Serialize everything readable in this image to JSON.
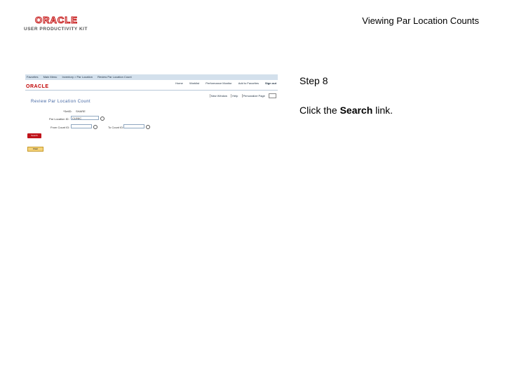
{
  "logo": {
    "wordmark": "ORACLE",
    "tagline": "USER PRODUCTIVITY KIT"
  },
  "document_title": "Viewing Par Location Counts",
  "step": {
    "label": "Step 8",
    "instruction_prefix": "Click the ",
    "instruction_bold": "Search",
    "instruction_suffix": " link."
  },
  "screenshot": {
    "nav_path": [
      "Favorites",
      "Main Menu",
      "Inventory > Par Location",
      "Review Par Location Count"
    ],
    "brand": "ORACLE",
    "top_links": [
      "Home",
      "Worklist",
      "Performance Monitor",
      "Add to Favorites",
      "Sign out"
    ],
    "util_links": [
      "New Window",
      "Help",
      "Personalize Page"
    ],
    "page_heading": "Review Par Location Count",
    "fields": {
      "setid_label": "*SetID:",
      "setid_value": "SHARE",
      "par_location_label": "Par Location ID:",
      "par_location_value": "CLINIC",
      "from_count_label": "From Count ID:",
      "to_count_label": "To Count ID:"
    },
    "search_button": "Search",
    "clear_button": "Clear"
  },
  "colors": {
    "oracle_red": "#c00000",
    "nav_bar": "#d3e0ec",
    "heading_blue": "#3e62a0",
    "search_button": "#c0141b"
  }
}
